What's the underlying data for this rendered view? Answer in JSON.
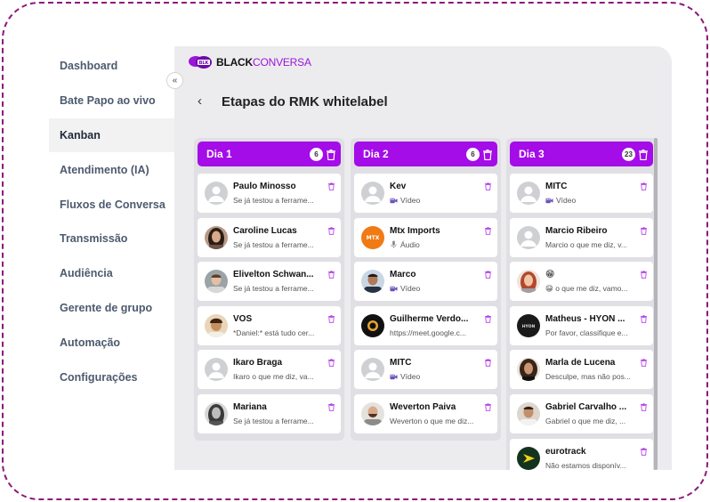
{
  "app": {
    "logo_part1": "BLACK",
    "logo_part2": "CONVERSA",
    "logo_mark_text": "BLK"
  },
  "sidebar": {
    "items": [
      {
        "label": "Dashboard",
        "active": false
      },
      {
        "label": "Bate Papo ao vivo",
        "active": false
      },
      {
        "label": "Kanban",
        "active": true
      },
      {
        "label": "Atendimento (IA)",
        "active": false
      },
      {
        "label": "Fluxos de Conversa",
        "active": false
      },
      {
        "label": "Transmissão",
        "active": false
      },
      {
        "label": "Audiência",
        "active": false
      },
      {
        "label": "Gerente de grupo",
        "active": false
      },
      {
        "label": "Automação",
        "active": false
      },
      {
        "label": "Configurações",
        "active": false
      }
    ],
    "collapse_icon": "«"
  },
  "page": {
    "back_icon": "‹",
    "title": "Etapas do RMK whitelabel"
  },
  "colors": {
    "accent": "#a40ce8",
    "frame": "#8b1a7a"
  },
  "columns": [
    {
      "title": "Dia 1",
      "count": "6",
      "cards": [
        {
          "name": "Paulo Minosso",
          "message": "Se já testou a ferrame...",
          "avatar": "placeholder",
          "icon": ""
        },
        {
          "name": "Caroline Lucas",
          "message": "Se já testou a ferrame...",
          "avatar": "photo-woman-dark-hair",
          "icon": ""
        },
        {
          "name": "Elivelton Schwan...",
          "message": "Se já testou a ferrame...",
          "avatar": "photo-man-light",
          "icon": ""
        },
        {
          "name": "VOS",
          "message": "*Daniel:* está tudo cer...",
          "avatar": "photo-portrait-warm",
          "icon": ""
        },
        {
          "name": "Ikaro Braga",
          "message": "Ikaro o que me diz, va...",
          "avatar": "placeholder",
          "icon": ""
        },
        {
          "name": "Mariana",
          "message": "Se já testou a ferrame...",
          "avatar": "photo-woman-bw",
          "icon": ""
        }
      ]
    },
    {
      "title": "Dia 2",
      "count": "6",
      "cards": [
        {
          "name": "Kev",
          "message": "Vídeo",
          "avatar": "placeholder",
          "icon": "video-icon"
        },
        {
          "name": "Mtx Imports",
          "message": "Áudio",
          "avatar": "logo-orange",
          "icon": "mic-icon",
          "avatar_text": "MTX"
        },
        {
          "name": "Marco",
          "message": "Vídeo",
          "avatar": "photo-man-dark",
          "icon": "video-icon"
        },
        {
          "name": "Guilherme Verdo...",
          "message": "https://meet.google.c...",
          "avatar": "logo-dark",
          "icon": ""
        },
        {
          "name": "MITC",
          "message": "Vídeo",
          "avatar": "placeholder",
          "icon": "video-icon"
        },
        {
          "name": "Weverton Paiva",
          "message": "Weverton o que me diz...",
          "avatar": "photo-man-beard",
          "icon": ""
        }
      ]
    },
    {
      "title": "Dia 3",
      "count": "23",
      "cards": [
        {
          "name": "MITC",
          "message": "Vídeo",
          "avatar": "placeholder",
          "icon": "video-icon"
        },
        {
          "name": "Marcio Ribeiro",
          "message": "Marcio o que me diz, v...",
          "avatar": "placeholder",
          "icon": ""
        },
        {
          "name": "😁",
          "message": "😁 o que me diz, vamo...",
          "avatar": "photo-woman-red",
          "icon": ""
        },
        {
          "name": "Matheus - HYON ...",
          "message": "Por favor, classifique e...",
          "avatar": "logo-black",
          "icon": "",
          "avatar_text": "HYON"
        },
        {
          "name": "Marla de Lucena",
          "message": "Desculpe, mas não pos...",
          "avatar": "photo-woman-curly",
          "icon": ""
        },
        {
          "name": "Gabriel Carvalho ...",
          "message": "Gabriel o que me diz, ...",
          "avatar": "photo-man-tan",
          "icon": ""
        },
        {
          "name": "eurotrack",
          "message": "Não estamos disponív...",
          "avatar": "logo-green",
          "icon": ""
        }
      ]
    }
  ]
}
